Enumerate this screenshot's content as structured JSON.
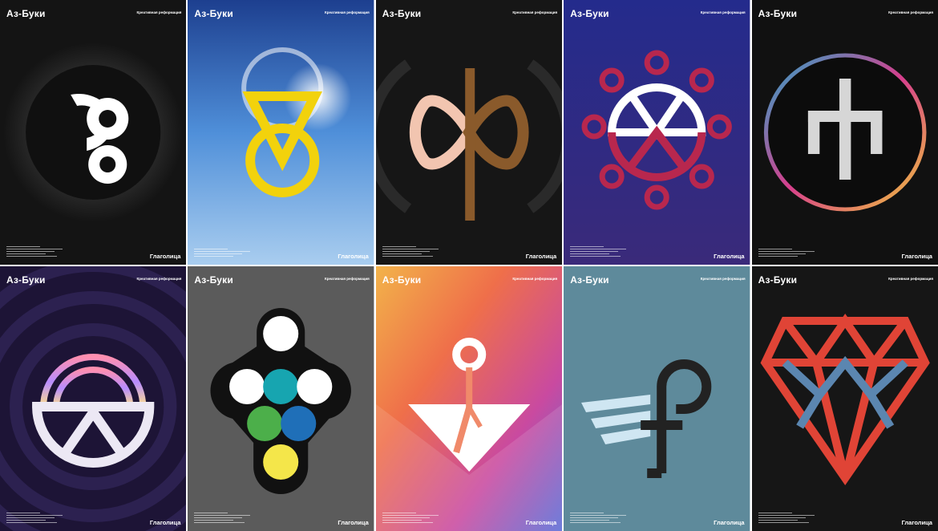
{
  "posters": [
    {
      "brand": "Аз-Буки",
      "subtitle": "Креативная реформация",
      "footer": "Глаголица",
      "symbol": "glagolitic-letter-1-icon",
      "background": "#141414",
      "accent": "#ffffff"
    },
    {
      "brand": "Аз-Буки",
      "subtitle": "Креативная реформация",
      "footer": "Глаголица",
      "symbol": "glagolitic-letter-2-icon",
      "background": "#2f6bc4",
      "accent": "#f2d20c"
    },
    {
      "brand": "Аз-Буки",
      "subtitle": "Креативная реформация",
      "footer": "Глаголица",
      "symbol": "glagolitic-letter-3-icon",
      "background": "#161616",
      "accent": "#8a5a2b"
    },
    {
      "brand": "Аз-Буки",
      "subtitle": "Креативная реформация",
      "footer": "Глаголица",
      "symbol": "glagolitic-letter-4-icon",
      "background": "#2a2c86",
      "accent": "#b8274e"
    },
    {
      "brand": "Аз-Буки",
      "subtitle": "Креативная реформация",
      "footer": "Глаголица",
      "symbol": "glagolitic-letter-5-icon",
      "background": "#111111",
      "accent": "#d6d6d6"
    },
    {
      "brand": "Аз-Буки",
      "subtitle": "Креативная реформация",
      "footer": "Глаголица",
      "symbol": "glagolitic-letter-6-icon",
      "background": "#1d1436",
      "accent": "#ece8f4"
    },
    {
      "brand": "Аз-Буки",
      "subtitle": "Креативная реформация",
      "footer": "Глаголица",
      "symbol": "glagolitic-letter-7-icon",
      "background": "#5b5b5b",
      "accent": "#ffffff"
    },
    {
      "brand": "Аз-Буки",
      "subtitle": "Креативная реформация",
      "footer": "Глаголица",
      "symbol": "glagolitic-letter-8-icon",
      "background": "#e8803c",
      "accent": "#ffffff"
    },
    {
      "brand": "Аз-Буки",
      "subtitle": "Креативная реформация",
      "footer": "Глаголица",
      "symbol": "glagolitic-letter-9-icon",
      "background": "#5e8a9b",
      "accent": "#222222"
    },
    {
      "brand": "Аз-Буки",
      "subtitle": "Креативная реформация",
      "footer": "Глаголица",
      "symbol": "glagolitic-letter-10-icon",
      "background": "#161616",
      "accent": "#e04436"
    }
  ]
}
